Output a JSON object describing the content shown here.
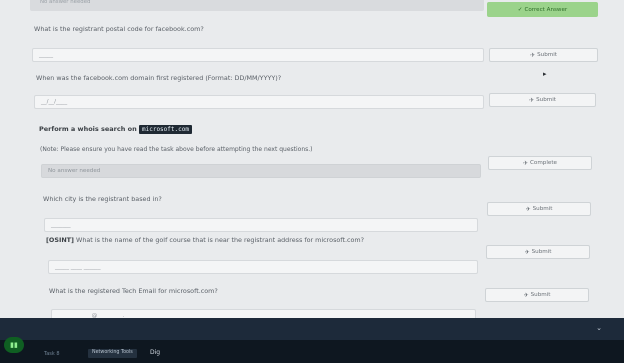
{
  "top": {
    "prev_input_value": "No answer needed",
    "correct_answer_label": "Correct Answer"
  },
  "questions": [
    {
      "text": "What is the registrant postal code for facebook.com?",
      "input_placeholder": "_____",
      "button": "Submit"
    },
    {
      "text": "When was the facebook.com domain first registered (Format: DD/MM/YYYY)?",
      "input_placeholder": "__/__/____",
      "button": "Submit"
    }
  ],
  "task_section": {
    "instruction_prefix": "Perform a whois search on",
    "domain_code": "microsoft.com",
    "note": "(Note: Please ensure you have read the task above before attempting the next questions.)",
    "no_answer_input": "No answer needed",
    "complete_button": "Complete"
  },
  "questions2": [
    {
      "text": "Which city is the registrant based in?",
      "input_placeholder": "_______",
      "button": "Submit"
    },
    {
      "tag": "[OSINT]",
      "text": " What is the name of the golf course that is near the registrant address for microsoft.com?",
      "input_placeholder": "_____ ____ ______",
      "button": "Submit"
    },
    {
      "text": "What is the registered Tech Email for microsoft.com?",
      "input_placeholder": "____________@_________._____",
      "button": "Submit"
    }
  ],
  "footer": {
    "task_label": "Task 8",
    "badge": "Networking Tools",
    "title": "Dig"
  }
}
